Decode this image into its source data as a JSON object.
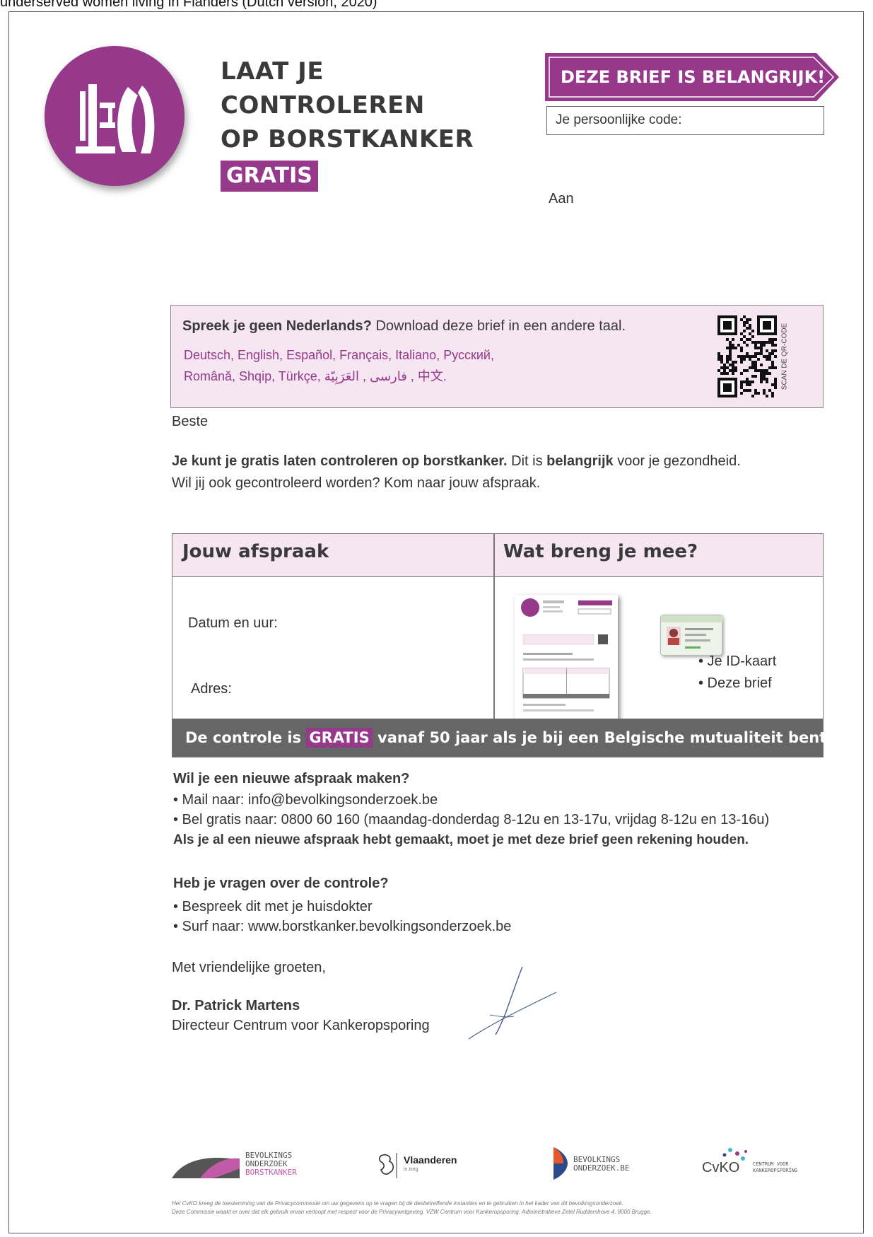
{
  "caption": "underserved women living in Flanders (Dutch version, 2020)",
  "header": {
    "headline": [
      "LAAT JE",
      "CONTROLEREN",
      "OP BORSTKANKER"
    ],
    "gratis": "GRATIS",
    "banner": "DEZE BRIEF IS BELANGRIJK!",
    "code_label": "Je persoonlijke code:",
    "aan": "Aan"
  },
  "language_box": {
    "question_bold": "Spreek je geen Nederlands?",
    "question_rest": " Download deze brief in een andere taal.",
    "languages_line1": "Deutsch, English, Español, Français, Italiano, Русский,",
    "languages_line2": "Română, Shqip, Türkçe, فارسی , العَرَبِيّة , 中文.",
    "qr_caption": "SCAN DE QR-CODE"
  },
  "body": {
    "greeting": "Beste",
    "intro_bold": "Je kunt je gratis laten controleren op borstkanker.",
    "intro_mid": " Dit is ",
    "intro_bold2": "belangrijk",
    "intro_end": " voor je gezondheid.",
    "intro_line2": "Wil jij ook gecontroleerd worden? Kom naar jouw afspraak."
  },
  "appointment": {
    "left_header": "Jouw afspraak",
    "right_header": "Wat breng je mee?",
    "date_label": "Datum en uur:",
    "address_label": "Adres:",
    "bring_items": [
      "• Je ID-kaart",
      "• Deze brief"
    ],
    "free_pre": "De controle is ",
    "free_tag": "GRATIS",
    "free_post": " vanaf 50 jaar als je bij een Belgische mutualiteit bent"
  },
  "new_appointment": {
    "heading": "Wil je een nieuwe afspraak maken?",
    "mail": "• Mail naar: info@bevolkingsonderzoek.be",
    "phone": "• Bel gratis naar: 0800 60 160 (maandag-donderdag 8-12u en 13-17u, vrijdag 8-12u en 13-16u)",
    "note": "Als je al een nieuwe afspraak hebt gemaakt, moet je met deze brief geen rekening houden."
  },
  "questions": {
    "heading": "Heb je vragen over de controle?",
    "item1": "• Bespreek dit met je huisdokter",
    "item2": "• Surf naar: www.borstkanker.bevolkingsonderzoek.be"
  },
  "closing": {
    "regards": "Met vriendelijke groeten,",
    "name": "Dr. Patrick Martens",
    "title": "Directeur Centrum voor Kankeropsporing"
  },
  "footer": {
    "logo1_line1": "BEVOLKINGS",
    "logo1_line2": "ONDERZOEK",
    "logo1_line3": "BORSTKANKER",
    "logo2": "Vlaanderen",
    "logo2_sub": "is zorg",
    "logo3_line1": "BEVOLKINGS",
    "logo3_line2": "ONDERZOEK.BE",
    "logo4": "CvKO",
    "logo4_line1": "CENTRUM VOOR",
    "logo4_line2": "KANKEROPSPORING",
    "fine1": "Het CvKO kreeg de toestemming van de Privacycommissie om uw gegevens op te vragen bij de desbetreffende instanties en te gebruiken in het kader van dit bevolkingsonderzoek.",
    "fine2": "Deze Commissie waakt er over dat elk gebruik ervan verloopt met respect voor de Privacywetgeving. VZW Centrum voor Kankeropsporing. Administratieve Zetel Ruddershove 4, 8000 Brugge."
  },
  "colors": {
    "accent": "#96398b",
    "tint": "#f5e6f1",
    "bar": "#666666"
  }
}
